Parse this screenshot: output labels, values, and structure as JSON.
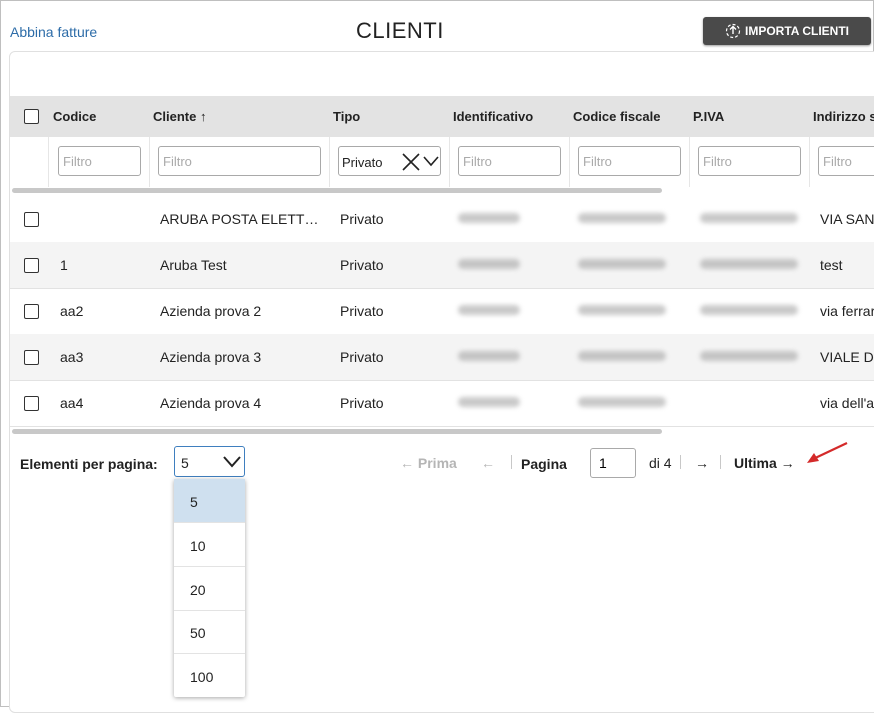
{
  "header": {
    "link_label": "Abbina fatture",
    "title": "CLIENTI",
    "import_label": "IMPORTA CLIENTI"
  },
  "table": {
    "columns": [
      "Codice",
      "Cliente ↑",
      "Tipo",
      "Identificativo",
      "Codice fiscale",
      "P.IVA",
      "Indirizzo s"
    ],
    "filter_placeholder": "Filtro",
    "tipo_filter_value": "Privato",
    "rows": [
      {
        "codice": "",
        "cliente": "ARUBA POSTA ELETT…",
        "tipo": "Privato",
        "indirizzo": "VIA SAN"
      },
      {
        "codice": "1",
        "cliente": "Aruba Test",
        "tipo": "Privato",
        "indirizzo": "test"
      },
      {
        "codice": "aa2",
        "cliente": "Azienda prova 2",
        "tipo": "Privato",
        "indirizzo": "via ferrar"
      },
      {
        "codice": "aa3",
        "cliente": "Azienda prova 3",
        "tipo": "Privato",
        "indirizzo": "VIALE D"
      },
      {
        "codice": "aa4",
        "cliente": "Azienda prova 4",
        "tipo": "Privato",
        "indirizzo": "via dell'a"
      }
    ]
  },
  "pager": {
    "per_page_label": "Elementi per pagina:",
    "per_page_value": "5",
    "per_page_options": [
      "5",
      "10",
      "20",
      "50",
      "100"
    ],
    "first_label": "← Prima",
    "prev_label": "←",
    "page_label": "Pagina",
    "page_value": "1",
    "of_label": "di 4",
    "next_label": "→",
    "last_label": "Ultima →"
  },
  "colors": {
    "link": "#2d6ca8",
    "header_bg": "#e3e3e3",
    "import_btn": "#4a4a4a",
    "selected_option": "#cfe0ef",
    "annotation_arrow": "#d42a2a"
  }
}
